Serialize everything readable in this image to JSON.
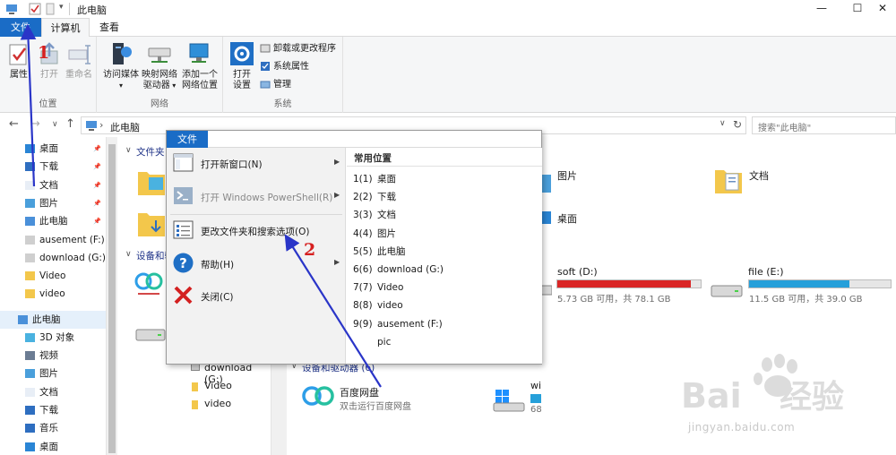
{
  "window": {
    "title": "此电脑",
    "controls": {
      "minimize": "—",
      "maximize": "☐",
      "close": "✕"
    }
  },
  "ribbon": {
    "tabs": [
      "文件",
      "计算机",
      "查看"
    ],
    "groups": {
      "location": {
        "label": "位置",
        "buttons": [
          "属性",
          "打开",
          "重命名"
        ]
      },
      "network": {
        "label": "网络",
        "buttons": [
          "访问媒体",
          "映射网络",
          "驱动器",
          "添加一个",
          "网络位置"
        ]
      },
      "system": {
        "label": "系统",
        "open_settings": [
          "打开",
          "设置"
        ],
        "small": [
          "卸载或更改程序",
          "系统属性",
          "管理"
        ]
      }
    }
  },
  "address": {
    "path": "此电脑",
    "search_placeholder": "搜索\"此电脑\""
  },
  "nav_pane": {
    "quick_access": [
      {
        "label": "桌面",
        "icon": "desktop-icon",
        "pinned": true
      },
      {
        "label": "下载",
        "icon": "download-icon",
        "pinned": true
      },
      {
        "label": "文档",
        "icon": "document-icon",
        "pinned": true
      },
      {
        "label": "图片",
        "icon": "picture-icon",
        "pinned": true
      },
      {
        "label": "此电脑",
        "icon": "computer-icon",
        "pinned": true
      },
      {
        "label": "ausement (F:)",
        "icon": "drive-icon",
        "pinned": false
      },
      {
        "label": "download (G:)",
        "icon": "drive-icon",
        "pinned": false
      },
      {
        "label": "Video",
        "icon": "folder-icon",
        "pinned": false
      },
      {
        "label": "video",
        "icon": "folder-icon",
        "pinned": false
      }
    ],
    "this_pc": {
      "label": "此电脑"
    },
    "this_pc_children": [
      {
        "label": "3D 对象",
        "icon": "3d-objects-icon"
      },
      {
        "label": "视频",
        "icon": "video-icon"
      },
      {
        "label": "图片",
        "icon": "picture-icon"
      },
      {
        "label": "文档",
        "icon": "document-icon"
      },
      {
        "label": "下载",
        "icon": "download-icon"
      },
      {
        "label": "音乐",
        "icon": "music-icon"
      },
      {
        "label": "桌面",
        "icon": "desktop-icon"
      }
    ],
    "pin_glyph": "📌"
  },
  "content": {
    "folders_header": "文件夹",
    "devices_header": "设备和驱动器",
    "devices_header_full": "设备和驱动器 (6)",
    "folders": [
      "图片",
      "文档",
      "桌面"
    ],
    "drives": [
      {
        "name": "soft (D:)",
        "info": "5.73 GB 可用，共 78.1 GB",
        "fill": 0.93,
        "color": "#da2626"
      },
      {
        "name": "file (E:)",
        "info": "11.5 GB 可用，共 39.0 GB",
        "fill": 0.71,
        "color": "#26a0da"
      }
    ],
    "baidu": {
      "name": "百度网盘",
      "desc": "双击运行百度网盘"
    },
    "lower_list": [
      "download (G:)",
      "Video",
      "video"
    ],
    "partial_label": "wi",
    "partial_info": "68"
  },
  "file_menu": {
    "tab": "文件",
    "items": [
      {
        "label": "打开新窗口(N)",
        "icon": "new-window-icon",
        "submenu": true,
        "enabled": true
      },
      {
        "label": "打开 Windows PowerShell(R)",
        "icon": "powershell-icon",
        "submenu": true,
        "enabled": false
      },
      {
        "label": "更改文件夹和搜索选项(O)",
        "icon": "folder-options-icon",
        "submenu": false,
        "enabled": true
      },
      {
        "label": "帮助(H)",
        "icon": "help-icon",
        "submenu": true,
        "enabled": true
      },
      {
        "label": "关闭(C)",
        "icon": "close-icon",
        "submenu": false,
        "enabled": true
      }
    ],
    "recent_header": "常用位置",
    "recent": [
      {
        "num": "1(1)",
        "label": "桌面"
      },
      {
        "num": "2(2)",
        "label": "下载"
      },
      {
        "num": "3(3)",
        "label": "文档"
      },
      {
        "num": "4(4)",
        "label": "图片"
      },
      {
        "num": "5(5)",
        "label": "此电脑"
      },
      {
        "num": "6(6)",
        "label": "download (G:)"
      },
      {
        "num": "7(7)",
        "label": "Video"
      },
      {
        "num": "8(8)",
        "label": "video"
      },
      {
        "num": "9(9)",
        "label": "ausement (F:)"
      },
      {
        "num": "",
        "label": "pic"
      }
    ]
  },
  "annotations": {
    "step1": "1",
    "step2": "2"
  },
  "watermark": {
    "brand": "Bai经验",
    "url": "jingyan.baidu.com"
  },
  "colors": {
    "accent": "#1a6cc6",
    "annotation": "#d62020",
    "arrow": "#2a35c8"
  }
}
